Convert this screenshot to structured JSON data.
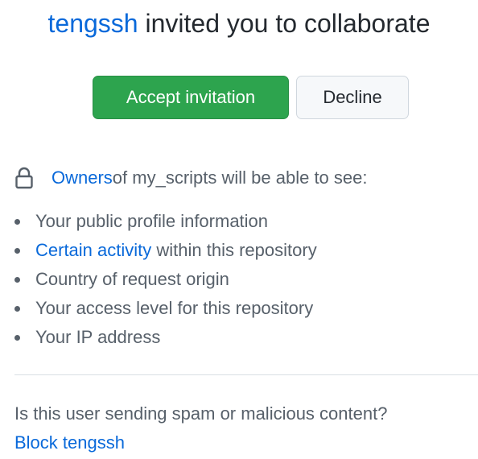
{
  "headline": {
    "user": "tengssh",
    "text": " invited you to collaborate"
  },
  "actions": {
    "accept_label": "Accept invitation",
    "decline_label": "Decline"
  },
  "visibility": {
    "lock_icon": "lock-icon",
    "owners_link": "Owners",
    "owners_text": " of my_scripts will be able to see:"
  },
  "shared_items": [
    {
      "link": "",
      "text": "Your public profile information"
    },
    {
      "link": "Certain activity",
      "text": " within this repository"
    },
    {
      "link": "",
      "text": "Country of request origin"
    },
    {
      "link": "",
      "text": "Your access level for this repository"
    },
    {
      "link": "",
      "text": "Your IP address"
    }
  ],
  "report": {
    "question": "Is this user sending spam or malicious content?",
    "block_link": "Block tengssh"
  },
  "colors": {
    "accent_link": "#0969da",
    "accept_button": "#2da44e",
    "muted_text": "#57606a"
  }
}
